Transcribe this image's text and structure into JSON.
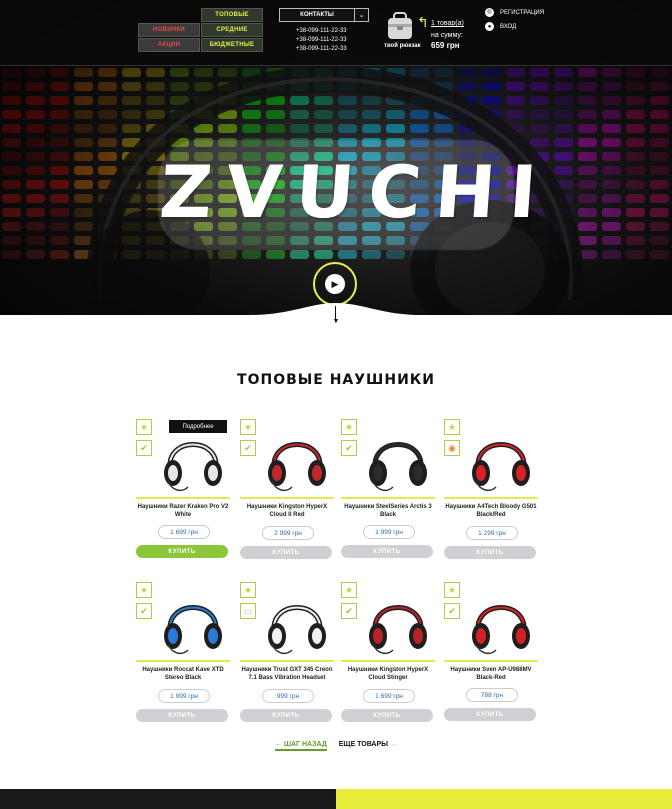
{
  "header": {
    "menu": [
      {
        "label": "Топовые",
        "style": "yellow"
      },
      {
        "label": "Новинки",
        "style": "dark"
      },
      {
        "label": "Средние",
        "style": "yellow"
      },
      {
        "label": "Акции",
        "style": "dark"
      },
      {
        "label": "Бюджетные",
        "style": "yellow"
      }
    ],
    "contacts_label": "КОНТАКТЫ",
    "phones": [
      "+38-099-111-22-33",
      "+38-099-111-22-33",
      "+38-099-111-22-33"
    ],
    "cart_label": "твой рюкзак",
    "cart_count": "1 товар(а)",
    "cart_sum_label": "на сумму:",
    "cart_sum": "659 грн",
    "register_label": "РЕГИСТРАЦИЯ",
    "login_label": "ВХОД"
  },
  "hero": {
    "logo": "ZVUCHI"
  },
  "section": {
    "title": "ТОПОВЫЕ НАУШНИКИ"
  },
  "products": [
    {
      "name": "Наушники Razer Kraken Pro V2 White",
      "price": "1 699 грн",
      "buy": "КУПИТЬ",
      "more": "Подробнее",
      "badge2": "check",
      "active": true,
      "color": "#e8e8e8"
    },
    {
      "name": "Наушники Kingston HyperX Cloud II Red",
      "price": "2 999 грн",
      "buy": "КУПИТЬ",
      "badge2": "check",
      "color": "#c0282d"
    },
    {
      "name": "Наушники SteelSeries Arctis 3 Black",
      "price": "1 999 грн",
      "buy": "КУПИТЬ",
      "badge2": "check",
      "color": "#2b2b2b"
    },
    {
      "name": "Наушники A4Tech Bloody G501 Black/Red",
      "price": "1 299 грн",
      "buy": "КУПИТЬ",
      "badge2": "orange",
      "color": "#d2232a"
    },
    {
      "name": "Наушники Roccat Kave XTD Stereo Black",
      "price": "1 999 грн",
      "buy": "КУПИТЬ",
      "badge2": "check",
      "color": "#2a7bd8"
    },
    {
      "name": "Наушники Trust GXT 345 Creon 7.1 Bass Vibration Headset",
      "price": "999 грн",
      "buy": "КУПИТЬ",
      "badge2": "gray",
      "color": "#f2f2f2"
    },
    {
      "name": "Наушники Kingston HyperX Cloud Stinger",
      "price": "1 699 грн",
      "buy": "КУПИТЬ",
      "badge2": "check",
      "color": "#b8222a"
    },
    {
      "name": "Наушники Sven AP-U988MV Black-Red",
      "price": "788 грн",
      "buy": "КУПИТЬ",
      "badge2": "check",
      "color": "#d42222"
    }
  ],
  "pager": {
    "back": "← ШАГ НАЗАД",
    "next": "ЕЩЕ ТОВАРЫ",
    "next_arrow": "→"
  },
  "colors": {
    "accent_yellow": "#e8ec3a",
    "buy_active": "#8cc63a",
    "buy_inactive": "#cfcfd4",
    "price_text": "#2a6fb6"
  }
}
